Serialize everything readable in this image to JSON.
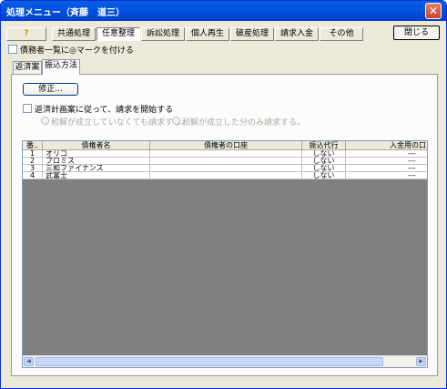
{
  "window": {
    "title": "処理メニュー（斉藤　道三）",
    "close_symbol": "✕"
  },
  "toolbar": {
    "help": "?",
    "buttons": [
      "共通処理",
      "任意整理",
      "訴訟処理",
      "個人再生",
      "破産処理",
      "請求入金",
      "その他"
    ],
    "active": "任意整理",
    "close_label": "閉じる"
  },
  "mark_checkbox_label": "債務者一覧に◎マークを付ける",
  "tabs": [
    "返済案",
    "振込方法"
  ],
  "active_tab": "振込方法",
  "panel": {
    "edit_button": "修正...",
    "start_checkbox_label": "返済計画案に従って、請求を開始する",
    "radio1_label": "和解が成立していなくても請求する。",
    "radio2_label": "和解が成立した分のみ請求する。"
  },
  "table": {
    "columns": [
      "番..",
      "債権者名",
      "債権者の口座",
      "振込代行",
      "入金用の口"
    ],
    "rows": [
      {
        "no": "1",
        "name": "オリコ",
        "account": "",
        "proxy": "しない",
        "deposit": "---"
      },
      {
        "no": "2",
        "name": "プロミス",
        "account": "",
        "proxy": "しない",
        "deposit": "---"
      },
      {
        "no": "3",
        "name": "三和ファイナンス",
        "account": "",
        "proxy": "しない",
        "deposit": "---"
      },
      {
        "no": "4",
        "name": "武富士",
        "account": "",
        "proxy": "しない",
        "deposit": "---"
      }
    ]
  },
  "scrollbar": {
    "left_arrow": "◀",
    "right_arrow": "▶"
  }
}
